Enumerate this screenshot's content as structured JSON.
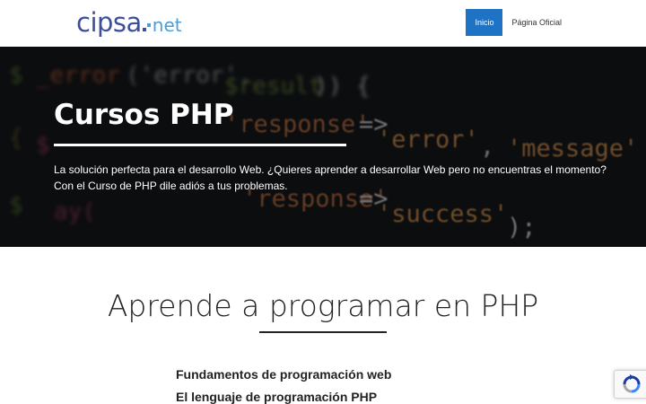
{
  "brand": {
    "logo_main": "cipsa",
    "logo_net": "net"
  },
  "nav": {
    "items": [
      {
        "label": "Inicio",
        "active": true
      },
      {
        "label": "Página Oficial",
        "active": false
      }
    ]
  },
  "hero": {
    "title": "Cursos PHP",
    "description": "La solución perfecta para el desarrollo Web. ¿Quieres aprender a desarrollar Web pero no encuentras el momento? Con el Curso de PHP dile adiós a tus problemas."
  },
  "content": {
    "title": "Aprende a programar en PHP",
    "topics": [
      "Fundamentos de programación web",
      "El lenguaje de programación PHP"
    ]
  },
  "colors": {
    "brand_blue": "#3d4e9e",
    "brand_light_blue": "#4a9fd6",
    "nav_active": "#1f73c4"
  },
  "icons": {
    "recaptcha": "recaptcha-icon"
  }
}
